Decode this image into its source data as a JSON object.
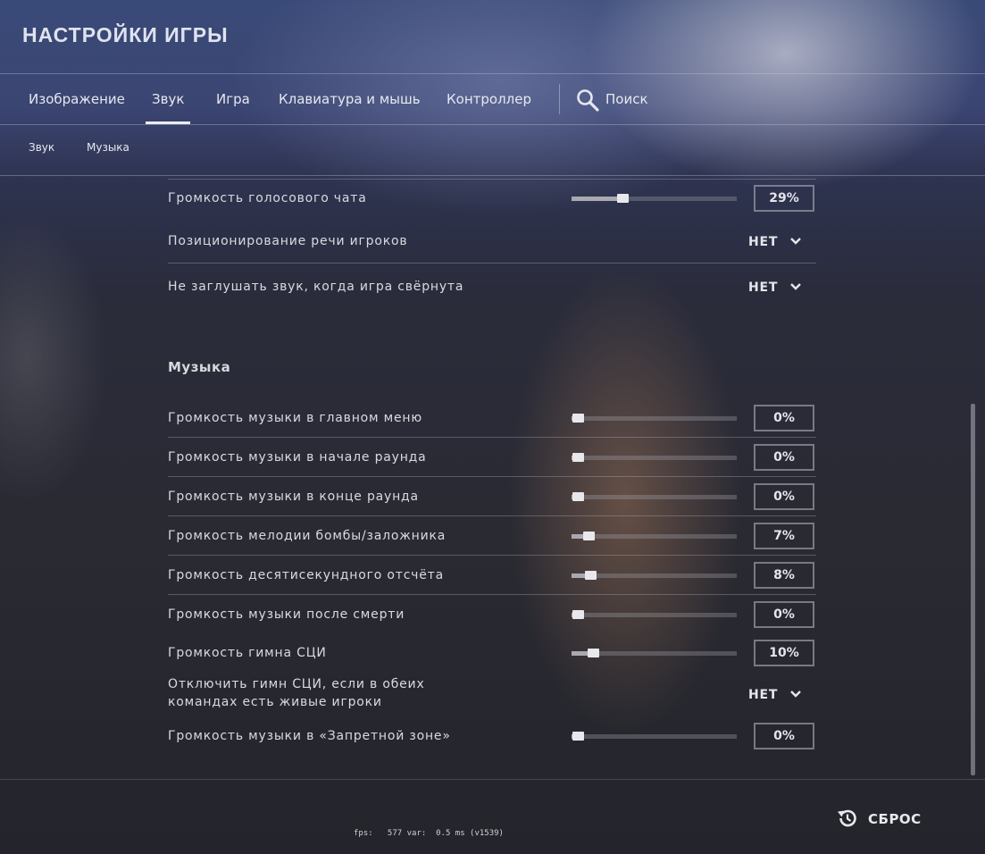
{
  "header": {
    "title": "НАСТРОЙКИ ИГРЫ"
  },
  "tabs": [
    {
      "label": "Изображение"
    },
    {
      "label": "Звук",
      "active": true
    },
    {
      "label": "Игра"
    },
    {
      "label": "Клавиатура и мышь"
    },
    {
      "label": "Контроллер"
    }
  ],
  "search": {
    "label": "Поиск",
    "icon": "search-icon"
  },
  "subtabs": [
    {
      "label": "Звук"
    },
    {
      "label": "Музыка"
    }
  ],
  "settings_top": [
    {
      "label": "Громкость голосового чата",
      "type": "slider",
      "value_text": "29%",
      "level": 0.29
    },
    {
      "label": "Позиционирование речи игроков",
      "type": "dropdown",
      "value_text": "НЕТ"
    },
    {
      "label": "Не заглушать звук, когда игра свёрнута",
      "type": "dropdown",
      "value_text": "НЕТ"
    }
  ],
  "music_section": {
    "title": "Музыка",
    "items": [
      {
        "label": "Громкость музыки в главном меню",
        "type": "slider",
        "value_text": "0%",
        "level": 0.0
      },
      {
        "label": "Громкость музыки в начале раунда",
        "type": "slider",
        "value_text": "0%",
        "level": 0.0
      },
      {
        "label": "Громкость музыки в конце раунда",
        "type": "slider",
        "value_text": "0%",
        "level": 0.0
      },
      {
        "label": "Громкость мелодии бомбы/заложника",
        "type": "slider",
        "value_text": "7%",
        "level": 0.07
      },
      {
        "label": "Громкость десятисекундного отсчёта",
        "type": "slider",
        "value_text": "8%",
        "level": 0.08
      },
      {
        "label": "Громкость музыки после смерти",
        "type": "slider",
        "value_text": "0%",
        "level": 0.0
      },
      {
        "label": "Громкость гимна СЦИ",
        "type": "slider",
        "value_text": "10%",
        "level": 0.1
      },
      {
        "label_line1": "Отключить гимн СЦИ, если в обеих",
        "label_line2": "командах есть живые игроки",
        "type": "dropdown",
        "value_text": "НЕТ"
      },
      {
        "label": "Громкость музыки в «Запретной зоне»",
        "type": "slider",
        "value_text": "0%",
        "level": 0.0
      }
    ]
  },
  "footer": {
    "reset_label": "СБРОС",
    "reset_icon": "reset-history-icon",
    "fps_text": "fps:   577 var:  0.5 ms (v1539)"
  }
}
